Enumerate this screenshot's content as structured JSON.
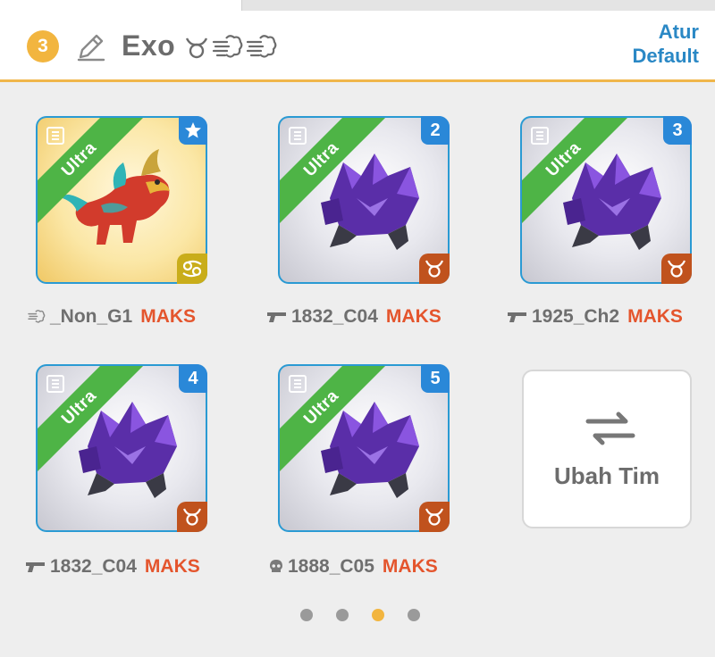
{
  "header": {
    "team_number": "3",
    "team_name": "Exo",
    "element_icons": [
      "taurus-icon",
      "wind-icon",
      "wind-icon"
    ],
    "default_link_line1": "Atur",
    "default_link_line2": "Default"
  },
  "cards": [
    {
      "rarity": "Ultra",
      "corner": "star-icon",
      "element": "cancer-icon",
      "caption_icon": "wind-icon",
      "name": "_Non_G1",
      "level": "MAKS"
    },
    {
      "rarity": "Ultra",
      "corner": "2",
      "element": "taurus-icon",
      "caption_icon": "gun-icon",
      "name": "1832_C04",
      "level": "MAKS"
    },
    {
      "rarity": "Ultra",
      "corner": "3",
      "element": "taurus-icon",
      "caption_icon": "gun-icon",
      "name": "1925_Ch2",
      "level": "MAKS"
    },
    {
      "rarity": "Ultra",
      "corner": "4",
      "element": "taurus-icon",
      "caption_icon": "gun-icon",
      "name": "1832_C04",
      "level": "MAKS"
    },
    {
      "rarity": "Ultra",
      "corner": "5",
      "element": "taurus-icon",
      "caption_icon": "skull-icon",
      "name": "1888_C05",
      "level": "MAKS"
    }
  ],
  "switch_team": {
    "label": "Ubah Tim",
    "icon": "swap-arrows-icon"
  },
  "pager": {
    "count": 4,
    "active_index": 2
  },
  "colors": {
    "accent": "#f2b53f",
    "link": "#2a88c5",
    "maks": "#e4552d",
    "ultra": "#4eb446"
  }
}
